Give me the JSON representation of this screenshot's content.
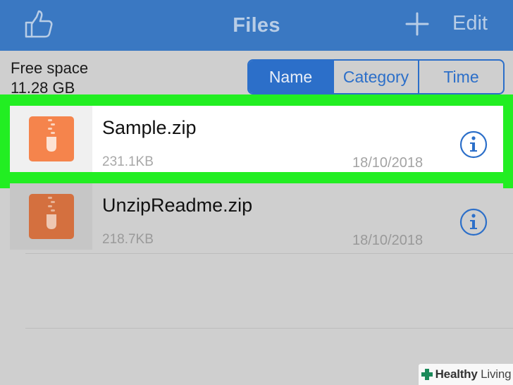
{
  "navbar": {
    "title": "Files",
    "edit_label": "Edit",
    "like_icon": "thumbs-up-icon",
    "add_icon": "plus-icon"
  },
  "storage": {
    "free_label": "Free space",
    "free_value": "11.28 GB"
  },
  "sort": {
    "options": [
      "Name",
      "Category",
      "Time"
    ],
    "active": "Name"
  },
  "files": [
    {
      "name": "Sample.zip",
      "size": "231.1KB",
      "date": "18/10/2018",
      "selected": true,
      "icon": "zip-file-icon"
    },
    {
      "name": "UnzipReadme.zip",
      "size": "218.7KB",
      "date": "18/10/2018",
      "selected": false,
      "icon": "zip-file-icon"
    }
  ],
  "watermark": {
    "brand": "Healthy",
    "brand_light": "Living"
  },
  "colors": {
    "navbar": "#3a78c2",
    "accent": "#2c6fc9",
    "highlight": "#22ee22",
    "zip_icon_selected": "#f5844c",
    "zip_icon_dim": "#d4703f"
  }
}
